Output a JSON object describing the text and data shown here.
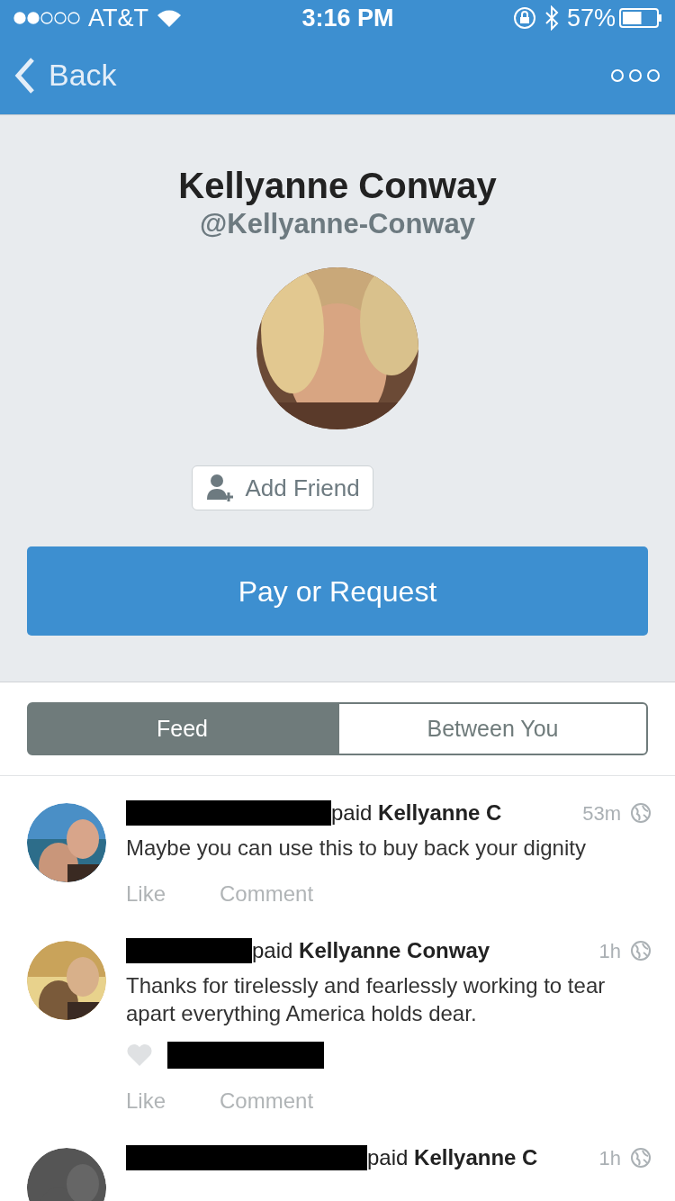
{
  "status_bar": {
    "carrier": "AT&T",
    "time": "3:16 PM",
    "battery": "57%"
  },
  "nav": {
    "back": "Back"
  },
  "profile": {
    "name": "Kellyanne Conway",
    "handle": "@Kellyanne-Conway",
    "add_friend": "Add Friend",
    "pay_button": "Pay or Request"
  },
  "tabs": [
    {
      "label": "Feed",
      "selected": true
    },
    {
      "label": "Between You",
      "selected": false
    }
  ],
  "feed": [
    {
      "action": "paid",
      "recipient": "Kellyanne C",
      "time": "53m",
      "message": "Maybe you can use this to buy back your dignity",
      "likes_shown": false,
      "like": "Like",
      "comment": "Comment"
    },
    {
      "action": "paid",
      "recipient": "Kellyanne Conway",
      "time": "1h",
      "message": "Thanks for tirelessly and fearlessly working to tear apart everything America holds dear.",
      "likes_shown": true,
      "like": "Like",
      "comment": "Comment"
    },
    {
      "action": "paid",
      "recipient": "Kellyanne C",
      "time": "1h"
    }
  ]
}
